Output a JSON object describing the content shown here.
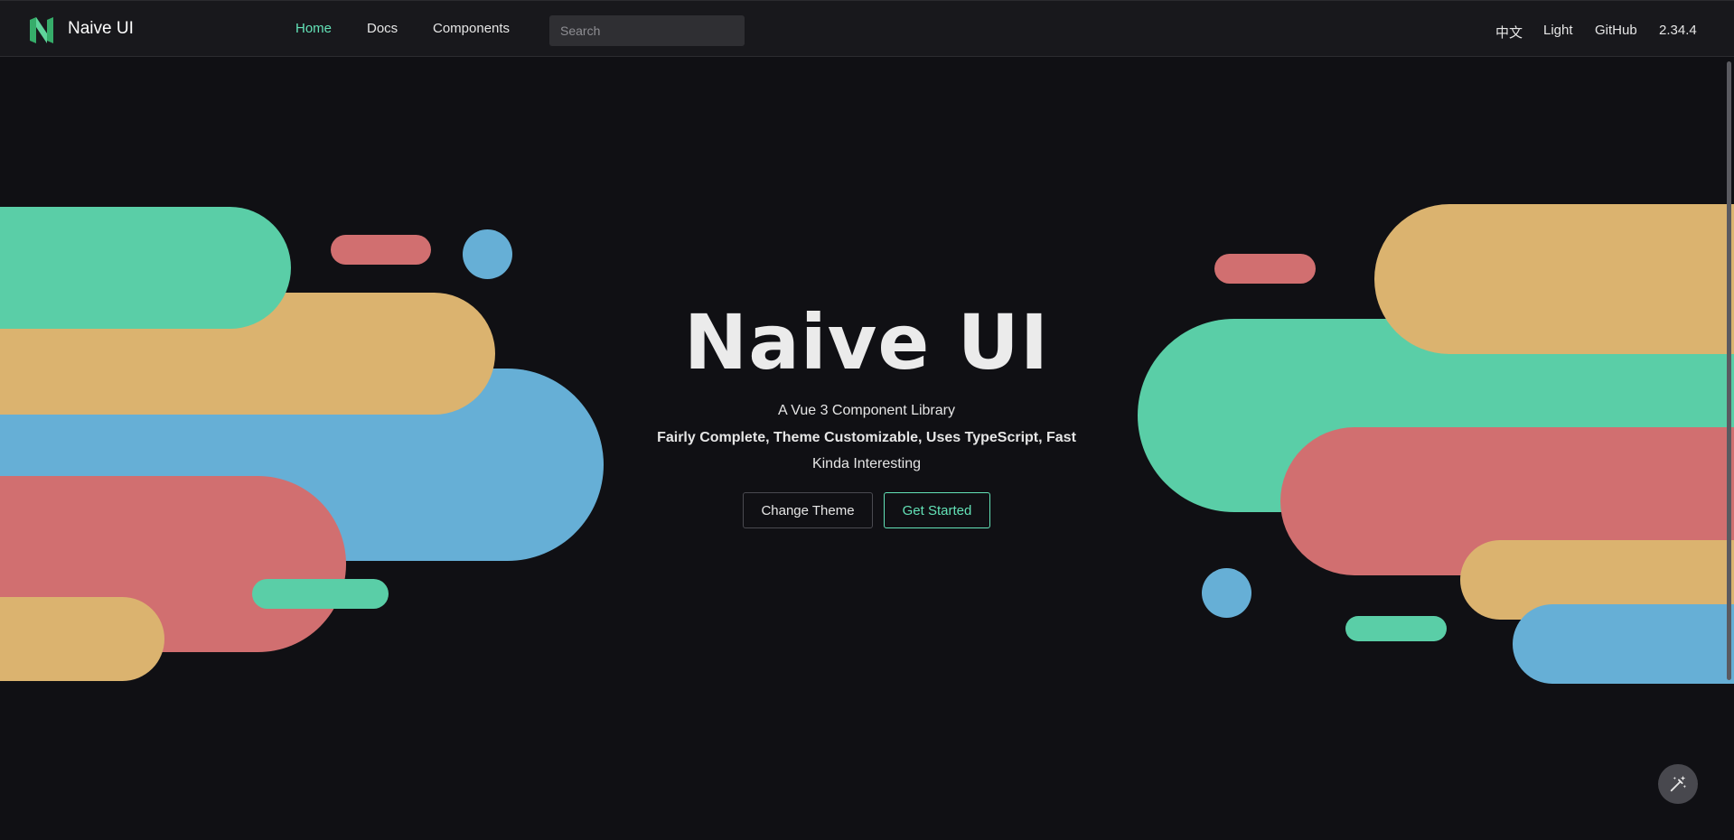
{
  "header": {
    "brand": "Naive UI",
    "nav": [
      "Home",
      "Docs",
      "Components"
    ],
    "search_placeholder": "Search",
    "lang": "中文",
    "theme_toggle": "Light",
    "github": "GitHub",
    "version": "2.34.4"
  },
  "hero": {
    "title": "Naive UI",
    "subtitle": "A Vue 3 Component Library",
    "features": "Fairly Complete, Theme Customizable, Uses TypeScript, Fast",
    "tagline": "Kinda Interesting",
    "buttons": {
      "change_theme": "Change Theme",
      "get_started": "Get Started"
    }
  },
  "colors": {
    "accent": "#63e2b7",
    "green": "#5acea7",
    "yellow": "#dbb36f",
    "blue": "#66afd6",
    "red": "#d16f70",
    "background": "#101014"
  },
  "icons": {
    "logo": "naive-ui-logo",
    "fab": "magic-wand-icon"
  }
}
